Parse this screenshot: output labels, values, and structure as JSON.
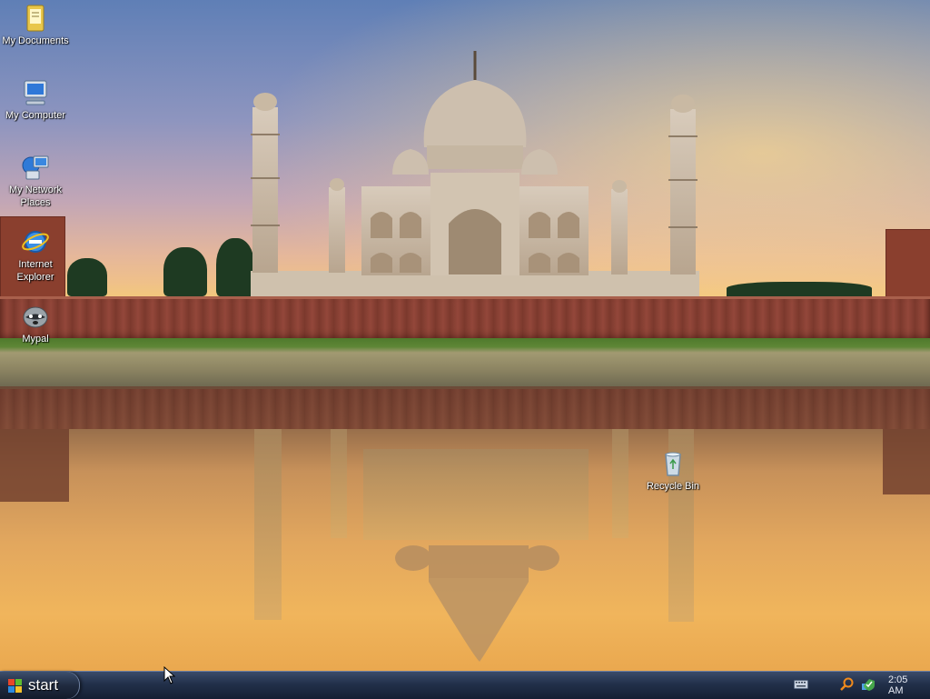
{
  "desktop": {
    "icons": [
      {
        "label": "My Documents",
        "icon": "my-documents-icon"
      },
      {
        "label": "My Computer",
        "icon": "my-computer-icon"
      },
      {
        "label": "My Network Places",
        "icon": "my-network-places-icon"
      },
      {
        "label": "Internet Explorer",
        "icon": "internet-explorer-icon"
      },
      {
        "label": "Mypal",
        "icon": "mypal-raccoon-icon"
      },
      {
        "label": "Recycle Bin",
        "icon": "recycle-bin-icon"
      }
    ],
    "wallpaper": "taj-mahal-sunset-reflection"
  },
  "taskbar": {
    "start_label": "start",
    "clock": "2:05 AM",
    "tray_icons": [
      "keyboard-icon",
      "search-icon",
      "network-shield-icon"
    ]
  },
  "colors": {
    "taskbar_top": "#3a4b6a",
    "taskbar_bottom": "#151f33",
    "sky_top": "#5f7fb6",
    "sky_horizon": "#f2c77e"
  }
}
